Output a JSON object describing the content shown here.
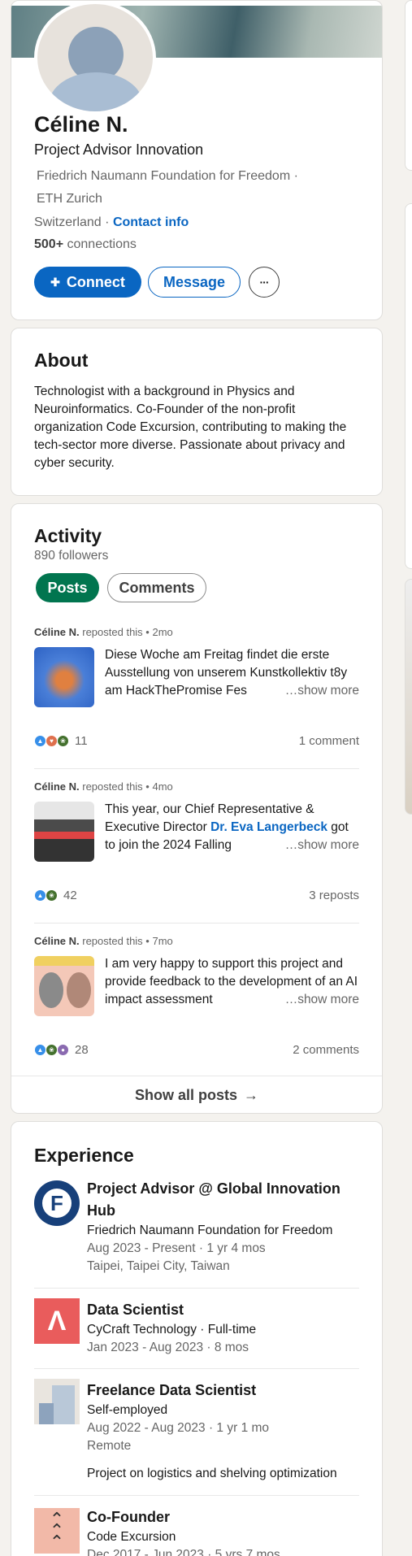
{
  "profile": {
    "name": "Céline N.",
    "headline": "Project Advisor Innovation",
    "org1": "Friedrich Naumann Foundation for Freedom",
    "org_separator": "·",
    "org2": "ETH Zurich",
    "location": "Switzerland",
    "location_sep": "·",
    "contact_info": "Contact info",
    "connections_count": "500+",
    "connections_label": "connections",
    "connect_label": "Connect",
    "message_label": "Message",
    "more_label": "···"
  },
  "about": {
    "title": "About",
    "text": "Technologist with a background in Physics and Neuroinformatics. Co-Founder of the non-profit organization Code Excursion, contributing to making the tech-sector more diverse. Passionate about privacy and cyber security."
  },
  "activity": {
    "title": "Activity",
    "followers": "890 followers",
    "tabs": [
      "Posts",
      "Comments"
    ],
    "posts": [
      {
        "author": "Céline N.",
        "action": "reposted this",
        "time": "2mo",
        "text": "Diese Woche am Freitag findet die erste Ausstellung von unserem Kunstkollektiv t8y am HackThePromise Fes",
        "more": "…show more",
        "reactions": "11",
        "stat": "1 comment"
      },
      {
        "author": "Céline N.",
        "action": "reposted this",
        "time": "4mo",
        "text_a": "This year, our Chief Representative & Executive Director ",
        "mention": "Dr. Eva Langerbeck",
        "text_b": " got to join the 2024 Falling",
        "more": "…show more",
        "reactions": "42",
        "stat": "3 reposts"
      },
      {
        "author": "Céline N.",
        "action": "reposted this",
        "time": "7mo",
        "text": "I am very happy to support this project and provide feedback to the development of an AI impact assessment",
        "more": "…show more",
        "reactions": "28",
        "stat": "2 comments"
      }
    ],
    "show_all": "Show all posts",
    "show_all_arrow": "→"
  },
  "experience": {
    "title": "Experience",
    "items": [
      {
        "title": "Project Advisor @ Global Innovation Hub",
        "company": "Friedrich Naumann Foundation for Freedom",
        "dates": "Aug 2023 - Present · 1 yr 4 mos",
        "location": "Taipei, Taipei City, Taiwan",
        "logo_letter": "F"
      },
      {
        "title": "Data Scientist",
        "company": "CyCraft Technology · Full-time",
        "dates": "Jan 2023 - Aug 2023 · 8 mos"
      },
      {
        "title": "Freelance Data Scientist",
        "company": "Self-employed",
        "dates": "Aug 2022 - Aug 2023 · 1 yr 1 mo",
        "location": "Remote",
        "description": "Project on logistics and shelving optimization"
      },
      {
        "title": "Co-Founder",
        "company": "Code Excursion",
        "dates": "Dec 2017 - Jun 2023 · 5 yrs 7 mos"
      }
    ]
  },
  "colors": {
    "brand_blue": "#0a66c2",
    "active_green": "#01754f"
  }
}
